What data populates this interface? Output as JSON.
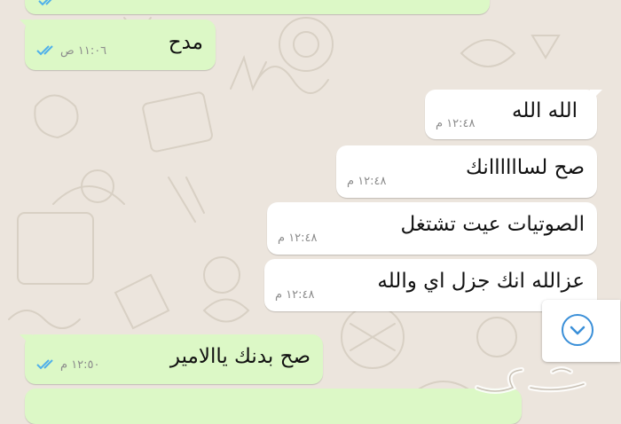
{
  "chat": {
    "colors": {
      "outgoing_bubble": "#dcf8c6",
      "incoming_bubble": "#ffffff",
      "wallpaper": "#ece5dd",
      "read_ticks": "#4fb0ea",
      "scroll_button_icon": "#3a8fd8"
    },
    "messages": [
      {
        "direction": "outgoing",
        "text": "مدح",
        "time": "١١:٠٦ ص",
        "status": "read"
      },
      {
        "direction": "incoming",
        "text": "الله الله",
        "time": "١٢:٤٨ م"
      },
      {
        "direction": "incoming",
        "text": "صح لساااااانك",
        "time": "١٢:٤٨ م"
      },
      {
        "direction": "incoming",
        "text": "الصوتيات عيت تشتغل",
        "time": "١٢:٤٨ م"
      },
      {
        "direction": "incoming",
        "text": "عزالله انك جزل اي والله",
        "time": "١٢:٤٨ م"
      },
      {
        "direction": "outgoing",
        "text": "صح بدنك ياالامير",
        "time": "١٢:٥٠ م",
        "status": "read"
      }
    ],
    "scroll_button": {
      "icon": "chevron-down-icon"
    },
    "watermark": {
      "icon": "haraj-logo"
    }
  }
}
